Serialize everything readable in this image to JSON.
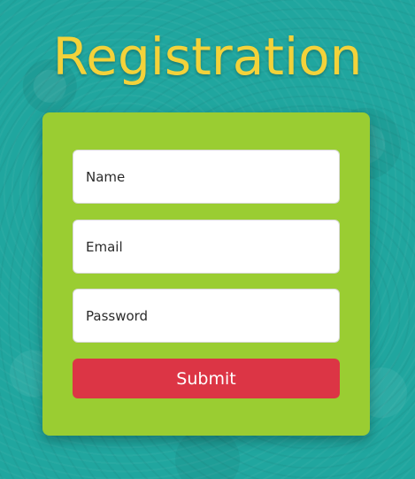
{
  "page": {
    "title": "Registration"
  },
  "form": {
    "name_placeholder": "Name",
    "email_placeholder": "Email",
    "password_placeholder": "Password",
    "name_value": "",
    "email_value": "",
    "password_value": "",
    "submit_label": "Submit"
  },
  "colors": {
    "background": "#20a69f",
    "title": "#f3d23a",
    "card": "#9acd32",
    "submit": "#dc3545"
  }
}
